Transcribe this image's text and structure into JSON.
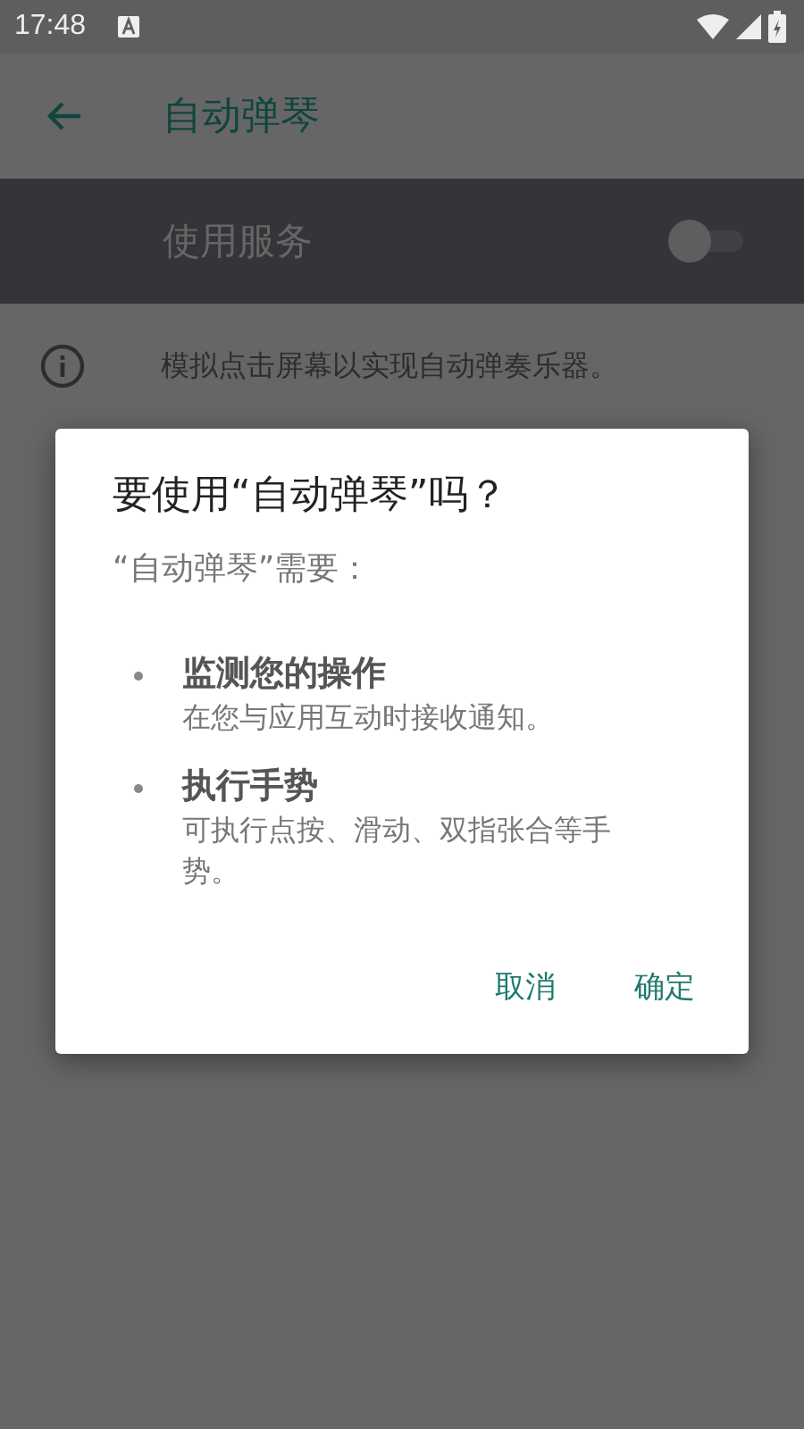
{
  "status_bar": {
    "time": "17:48"
  },
  "app_bar": {
    "title": "自动弹琴"
  },
  "service_row": {
    "label": "使用服务",
    "on": false
  },
  "info": {
    "text": "模拟点击屏幕以实现自动弹奏乐器。"
  },
  "dialog": {
    "title": "要使用“自动弹琴”吗？",
    "subtitle": "“自动弹琴”需要：",
    "items": [
      {
        "title": "监测您的操作",
        "description": "在您与应用互动时接收通知。"
      },
      {
        "title": "执行手势",
        "description": "可执行点按、滑动、双指张合等手势。"
      }
    ],
    "buttons": [
      "取消",
      "确定"
    ]
  }
}
